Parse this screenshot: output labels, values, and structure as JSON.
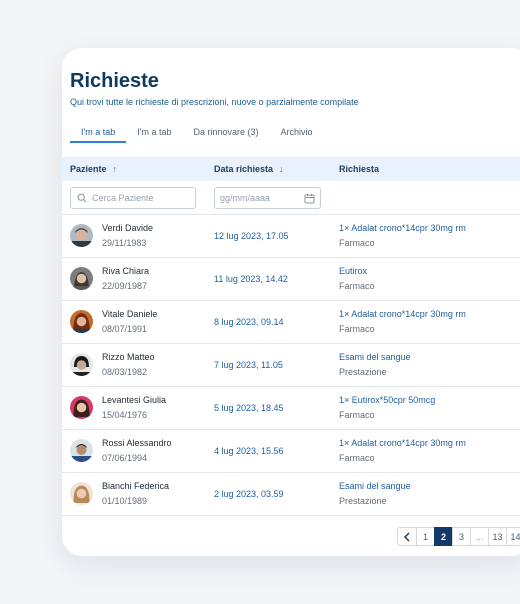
{
  "header": {
    "title": "Richieste",
    "subtitle": "Qui trovi tutte le richieste di prescrizioni, nuove o parzialmente compilate"
  },
  "tabs": [
    {
      "label": "I'm a tab",
      "active": true
    },
    {
      "label": "I'm a tab",
      "active": false
    },
    {
      "label": "Da rinnovare (3)",
      "active": false
    },
    {
      "label": "Archivio",
      "active": false
    }
  ],
  "table": {
    "columns": {
      "patient": "Paziente",
      "date": "Data richiesta",
      "request": "Richiesta"
    },
    "filters": {
      "search_placeholder": "Cerca Paziente",
      "date_placeholder": "gg/mm/aaaa"
    },
    "rows": [
      {
        "name": "Verdi Davide",
        "dob": "29/11/1983",
        "date": "12 lug 2023, 17.05",
        "request": "1× Adalat crono*14cpr 30mg rm",
        "type": "Farmaco"
      },
      {
        "name": "Riva Chiara",
        "dob": "22/09/1987",
        "date": "11 lug 2023, 14.42",
        "request": "Eutirox",
        "type": "Farmaco"
      },
      {
        "name": "Vitale Daniele",
        "dob": "08/07/1991",
        "date": "8 lug 2023, 09.14",
        "request": "1× Adalat crono*14cpr 30mg rm",
        "type": "Farmaco"
      },
      {
        "name": "Rizzo Matteo",
        "dob": "08/03/1982",
        "date": "7 lug 2023, 11.05",
        "request": "Esami del sangue",
        "type": "Prestazione"
      },
      {
        "name": "Levantesi Giulia",
        "dob": "15/04/1976",
        "date": "5 lug 2023, 18.45",
        "request": "1× Eutirox*50cpr 50mcg",
        "type": "Farmaco"
      },
      {
        "name": "Rossi Alessandro",
        "dob": "07/06/1994",
        "date": "4 lug 2023, 15.56",
        "request": "1× Adalat crono*14cpr 30mg rm",
        "type": "Farmaco"
      },
      {
        "name": "Bianchi Federica",
        "dob": "01/10/1989",
        "date": "2 lug 2023, 03.59",
        "request": "Esami del sangue",
        "type": "Prestazione"
      }
    ]
  },
  "pagination": {
    "pages": [
      "1",
      "2",
      "3",
      "...",
      "13",
      "14"
    ],
    "current": "2"
  },
  "colors": {
    "title": "#0e3a5e",
    "accent": "#2f7fd8",
    "header_bg": "#e9f1fd",
    "pager_active": "#13386a"
  },
  "icons": {
    "sort_asc": "arrow-up-icon",
    "sort_desc": "arrow-down-icon",
    "search": "search-icon",
    "calendar": "calendar-icon",
    "prev": "chevron-left-icon"
  }
}
